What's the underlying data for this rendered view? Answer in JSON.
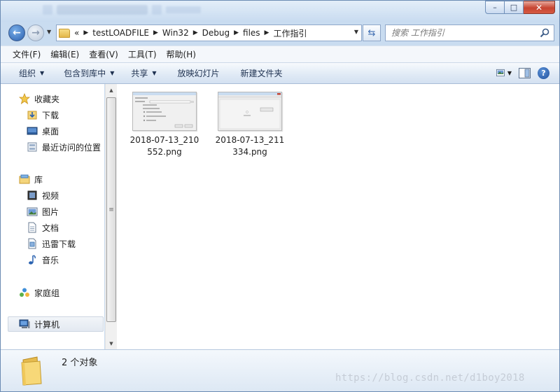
{
  "window": {
    "caption_min": "–",
    "caption_max": "□",
    "caption_close": "✕"
  },
  "address": {
    "overflow": "«",
    "crumbs": [
      "testLOADFILE",
      "Win32",
      "Debug",
      "files",
      "工作指引"
    ]
  },
  "search": {
    "placeholder": "搜索 工作指引"
  },
  "menu": [
    "文件(F)",
    "编辑(E)",
    "查看(V)",
    "工具(T)",
    "帮助(H)"
  ],
  "commands": [
    {
      "label": "组织",
      "dropdown": true
    },
    {
      "label": "包含到库中",
      "dropdown": true
    },
    {
      "label": "共享",
      "dropdown": true
    },
    {
      "label": "放映幻灯片",
      "dropdown": false
    },
    {
      "label": "新建文件夹",
      "dropdown": false
    }
  ],
  "nav": {
    "favorites": {
      "label": "收藏夹",
      "icon": "star-icon"
    },
    "favorites_items": [
      {
        "label": "下载",
        "icon": "downloads-icon"
      },
      {
        "label": "桌面",
        "icon": "desktop-icon"
      },
      {
        "label": "最近访问的位置",
        "icon": "recent-places-icon"
      }
    ],
    "libraries": {
      "label": "库",
      "icon": "library-icon"
    },
    "libraries_items": [
      {
        "label": "视频",
        "icon": "video-icon"
      },
      {
        "label": "图片",
        "icon": "pictures-icon"
      },
      {
        "label": "文档",
        "icon": "documents-icon"
      },
      {
        "label": "迅雷下载",
        "icon": "thunder-download-icon"
      },
      {
        "label": "音乐",
        "icon": "music-icon"
      }
    ],
    "homegroup": {
      "label": "家庭组",
      "icon": "homegroup-icon"
    },
    "computer": {
      "label": "计算机",
      "icon": "computer-icon",
      "selected": true
    }
  },
  "files": [
    {
      "name_line1": "2018-07-13_210",
      "name_line2": "552.png"
    },
    {
      "name_line1": "2018-07-13_211",
      "name_line2": "334.png"
    }
  ],
  "status": {
    "count_text": "2 个对象"
  },
  "watermark": "https://blog.csdn.net/d1boy2018",
  "colors": {
    "accent": "#3b6bb0",
    "selection": "#e3e9f1",
    "close_button": "#c74431"
  }
}
